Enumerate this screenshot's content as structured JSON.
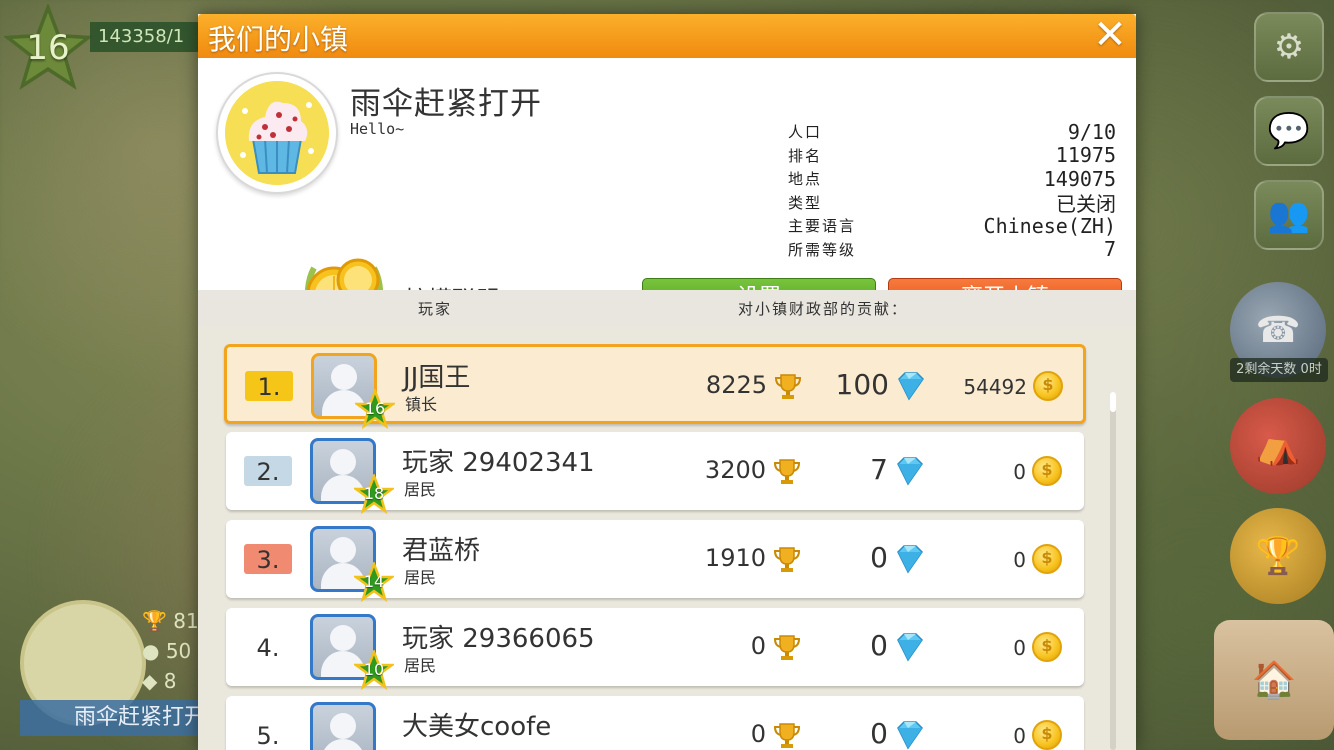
{
  "hud": {
    "level": "16",
    "xp_text": "143358/1",
    "left_stats": [
      "81",
      "50",
      "8"
    ],
    "left_name": "雨伞赶紧打开",
    "timer_text": "2剩余天数 0时"
  },
  "dialog": {
    "title": "我们的小镇",
    "town": {
      "name": "雨伞赶紧打开",
      "description": "Hello~",
      "stats": [
        {
          "key": "人口",
          "value": "9/10"
        },
        {
          "key": "排名",
          "value": "11975"
        },
        {
          "key": "地点",
          "value": "149075"
        },
        {
          "key": "类型",
          "value": "已关闭"
        },
        {
          "key": "主要语言",
          "value": "Chinese(ZH)"
        },
        {
          "key": "所需等级",
          "value": "7"
        }
      ],
      "alliance": "柠檬联盟"
    },
    "buttons": {
      "settings": "设置",
      "leave": "离开小镇"
    },
    "columns": {
      "player": "玩家",
      "contribution": "对小镇财政部的贡献："
    },
    "players": [
      {
        "rank": "1.",
        "rank_color": "#f5c518",
        "name": "JJ国王",
        "role": "镇长",
        "level": "16",
        "trophies": "8225",
        "gems": "100",
        "coins": "54492",
        "highlight": true
      },
      {
        "rank": "2.",
        "rank_color": "#c5d8e6",
        "name": "玩家 29402341",
        "role": "居民",
        "level": "18",
        "trophies": "3200",
        "gems": "7",
        "coins": "0"
      },
      {
        "rank": "3.",
        "rank_color": "#f08a70",
        "name": "君蓝桥",
        "role": "居民",
        "level": "14",
        "trophies": "1910",
        "gems": "0",
        "coins": "0"
      },
      {
        "rank": "4.",
        "rank_color": "#ffffff",
        "name": "玩家 29366065",
        "role": "居民",
        "level": "10",
        "trophies": "0",
        "gems": "0",
        "coins": "0"
      },
      {
        "rank": "5.",
        "rank_color": "#ffffff",
        "name": "大美女coofe",
        "role": "",
        "level": "",
        "trophies": "0",
        "gems": "0",
        "coins": "0"
      }
    ]
  }
}
